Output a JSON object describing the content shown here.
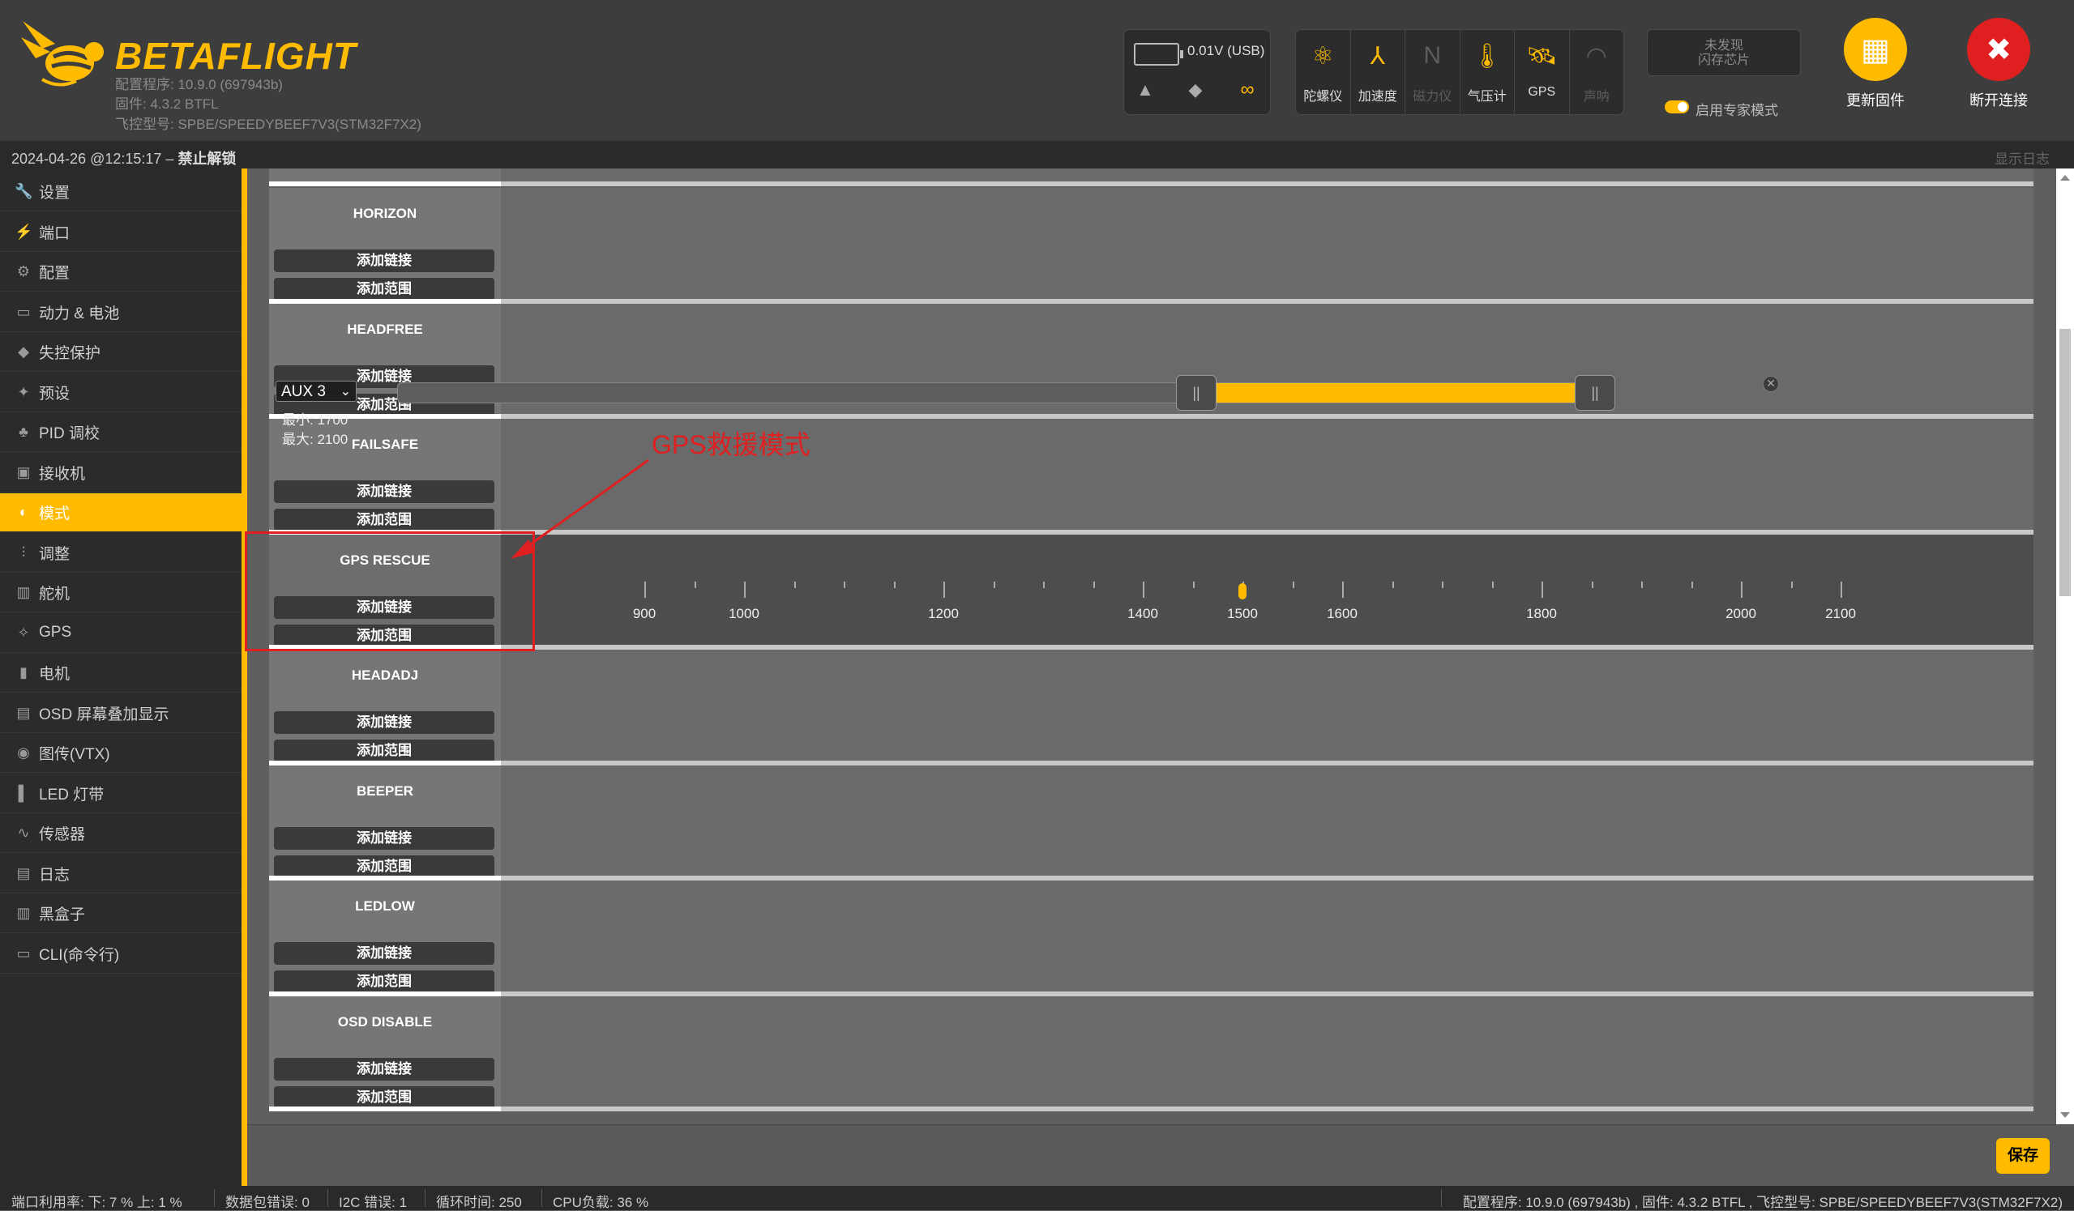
{
  "header": {
    "brand": "BETAFLIGHT",
    "configurator_version": "配置程序: 10.9.0 (697943b)",
    "firmware_version": "固件: 4.3.2 BTFL",
    "board_type": "飞控型号: SPBE/SPEEDYBEEF7V3(STM32F7X2)",
    "voltage": "0.01V (USB)",
    "sensors": [
      {
        "label": "陀螺仪",
        "icon": "gyro-icon",
        "active": true
      },
      {
        "label": "加速度",
        "icon": "accel-icon",
        "active": true
      },
      {
        "label": "磁力仪",
        "icon": "mag-icon",
        "active": false
      },
      {
        "label": "气压计",
        "icon": "baro-icon",
        "active": true
      },
      {
        "label": "GPS",
        "icon": "gps-icon",
        "active": true
      },
      {
        "label": "声呐",
        "icon": "sonar-icon",
        "active": false
      }
    ],
    "dataflash_line1": "未发现",
    "dataflash_line2": "闪存芯片",
    "expert_mode_label": "启用专家模式",
    "update_firmware_label": "更新固件",
    "disconnect_label": "断开连接"
  },
  "topbar": {
    "datetime": "2024-04-26 @12:15:17 – ",
    "arming_status": "禁止解锁",
    "show_log": "显示日志"
  },
  "sidebar": {
    "items": [
      {
        "label": "设置",
        "icon": "wrench-icon"
      },
      {
        "label": "端口",
        "icon": "plug-icon"
      },
      {
        "label": "配置",
        "icon": "gear-icon"
      },
      {
        "label": "动力 & 电池",
        "icon": "battery-icon"
      },
      {
        "label": "失控保护",
        "icon": "parachute-icon"
      },
      {
        "label": "预设",
        "icon": "wand-icon"
      },
      {
        "label": "PID 调校",
        "icon": "pid-icon"
      },
      {
        "label": "接收机",
        "icon": "receiver-icon"
      },
      {
        "label": "模式",
        "icon": "toggle-icon",
        "active": true
      },
      {
        "label": "调整",
        "icon": "sliders-icon"
      },
      {
        "label": "舵机",
        "icon": "servo-icon"
      },
      {
        "label": "GPS",
        "icon": "satellite-icon"
      },
      {
        "label": "电机",
        "icon": "motor-icon"
      },
      {
        "label": "OSD 屏幕叠加显示",
        "icon": "osd-icon"
      },
      {
        "label": "图传(VTX)",
        "icon": "antenna-icon"
      },
      {
        "label": "LED 灯带",
        "icon": "led-icon"
      },
      {
        "label": "传感器",
        "icon": "pulse-icon"
      },
      {
        "label": "日志",
        "icon": "log-icon"
      },
      {
        "label": "黑盒子",
        "icon": "blackbox-icon"
      },
      {
        "label": "CLI(命令行)",
        "icon": "terminal-icon"
      }
    ]
  },
  "modes": {
    "add_link": "添加链接",
    "add_range": "添加范围",
    "items": [
      {
        "name": "HORIZON"
      },
      {
        "name": "HEADFREE"
      },
      {
        "name": "FAILSAFE"
      },
      {
        "name": "GPS RESCUE",
        "active": true
      },
      {
        "name": "HEADADJ"
      },
      {
        "name": "BEEPER"
      },
      {
        "name": "LEDLOW"
      },
      {
        "name": "OSD DISABLE"
      }
    ],
    "gps_rescue_range": {
      "channel": "AUX 3",
      "min_label": "最小: 1700",
      "max_label": "最大: 2100",
      "min": 1700,
      "max": 2100,
      "current": 1500,
      "scale_min": 900,
      "scale_max": 2100,
      "tick_labels": [
        "900",
        "1000",
        "1200",
        "1400",
        "1500",
        "1600",
        "1800",
        "2000",
        "2100"
      ]
    }
  },
  "annotation": {
    "text": "GPS救援模式"
  },
  "toolbar": {
    "save_label": "保存"
  },
  "statusbar": {
    "port_util": "端口利用率:   下: 7 % 上: 1 %",
    "packet_error": "数据包错误: 0",
    "i2c_error": "I2C 错误: 1",
    "cycle_time": "循环时间: 250",
    "cpu_load": "CPU负载: 36 %",
    "version_info": "配置程序: 10.9.0 (697943b) , 固件: 4.3.2 BTFL , 飞控型号: SPBE/SPEEDYBEEF7V3(STM32F7X2)"
  },
  "colors": {
    "accent": "#ffbb00",
    "danger": "#e02020"
  }
}
